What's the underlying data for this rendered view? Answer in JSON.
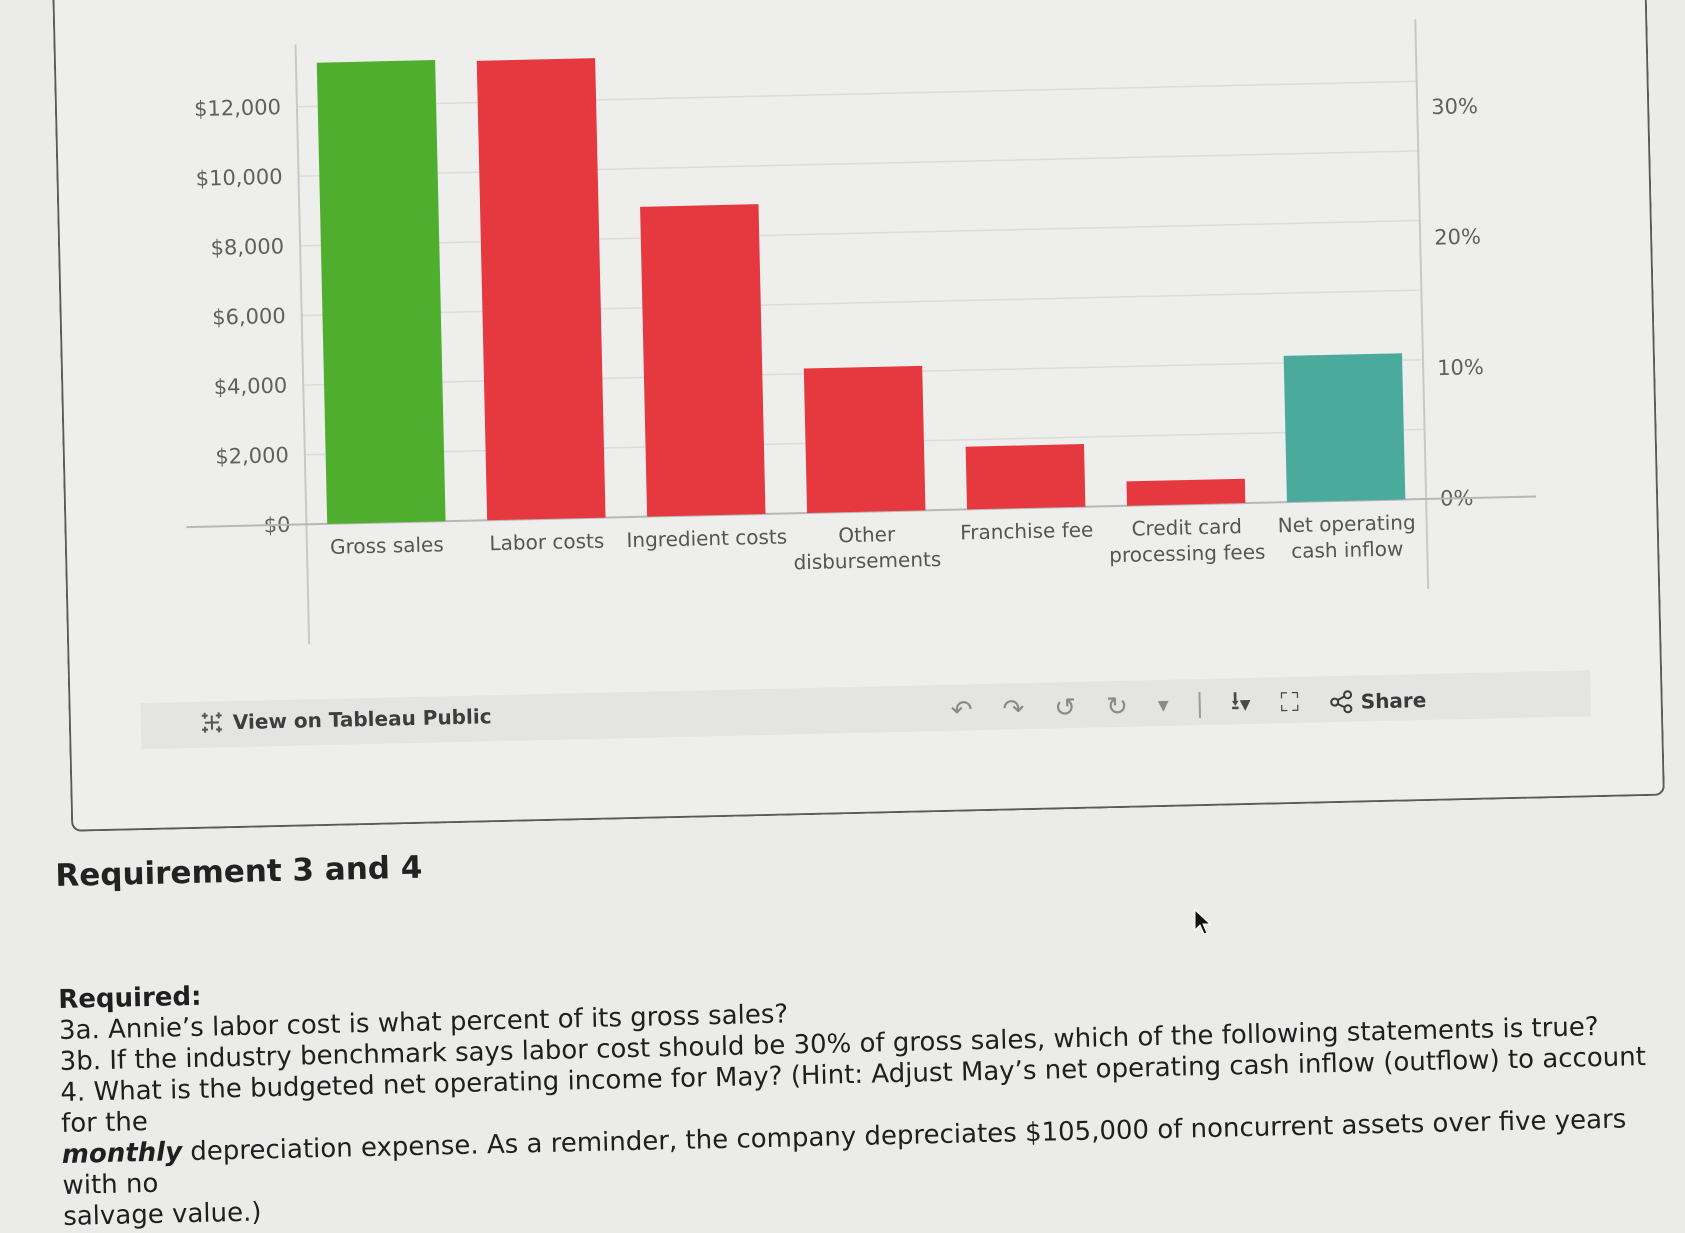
{
  "chart_data": {
    "type": "bar",
    "title": "",
    "xlabel": "",
    "ylabel": "",
    "categories": [
      "Gross sales",
      "Labor costs",
      "Ingredient costs",
      "Other disbursements",
      "Franchise fee",
      "Credit card processing fees",
      "Net operating cash inflow"
    ],
    "category_lines": [
      [
        "Gross sales"
      ],
      [
        "Labor costs"
      ],
      [
        "Ingredient costs"
      ],
      [
        "Other",
        "disbursements"
      ],
      [
        "Franchise fee"
      ],
      [
        "Credit card",
        "processing fees"
      ],
      [
        "Net operating",
        "cash inflow"
      ]
    ],
    "values": [
      13250,
      13200,
      8900,
      4150,
      1800,
      700,
      4200
    ],
    "colors": [
      "#4fae2e",
      "#e5383f",
      "#e5383f",
      "#e5383f",
      "#e5383f",
      "#e5383f",
      "#4aaa9c"
    ],
    "ylim": [
      0,
      13500
    ],
    "left_axis_ticks": [
      {
        "value": 0,
        "label": "$0"
      },
      {
        "value": 2000,
        "label": "$2,000"
      },
      {
        "value": 4000,
        "label": "$4,000"
      },
      {
        "value": 6000,
        "label": "$6,000"
      },
      {
        "value": 8000,
        "label": "$8,000"
      },
      {
        "value": 10000,
        "label": "$10,000"
      },
      {
        "value": 12000,
        "label": "$12,000"
      }
    ],
    "right_axis_ticks": [
      {
        "value": 0,
        "label": "0%"
      },
      {
        "value": 10,
        "label": "10%"
      },
      {
        "value": 20,
        "label": "20%"
      },
      {
        "value": 30,
        "label": "30%"
      }
    ],
    "right_ylim": [
      0,
      36
    ],
    "grid": true,
    "legend": "none"
  },
  "toolbar": {
    "view_public_label": "View on Tableau Public",
    "share_label": "Share",
    "icons": [
      "undo-icon",
      "redo-icon",
      "revert-icon",
      "refresh-icon",
      "dropdown-arrow-icon",
      "download-icon",
      "fullscreen-icon",
      "share-icon"
    ]
  },
  "content": {
    "section_title": "Requirement 3 and 4",
    "required_label": "Required:",
    "q3a": "3a. Annie’s labor cost is what percent of its gross sales?",
    "q3b": "3b. If the industry benchmark says labor cost should be 30% of gross sales, which of the following statements is true?",
    "q4_part1": "4. What is the budgeted net operating income for May? (Hint: Adjust May’s net operating cash inflow (outflow) to account for the",
    "q4_part2": "depreciation expense. As a reminder, the company depreciates $105,000 of noncurrent assets over five years with no",
    "q4_emphasis": "monthly",
    "q4_part3": "salvage value.)"
  }
}
